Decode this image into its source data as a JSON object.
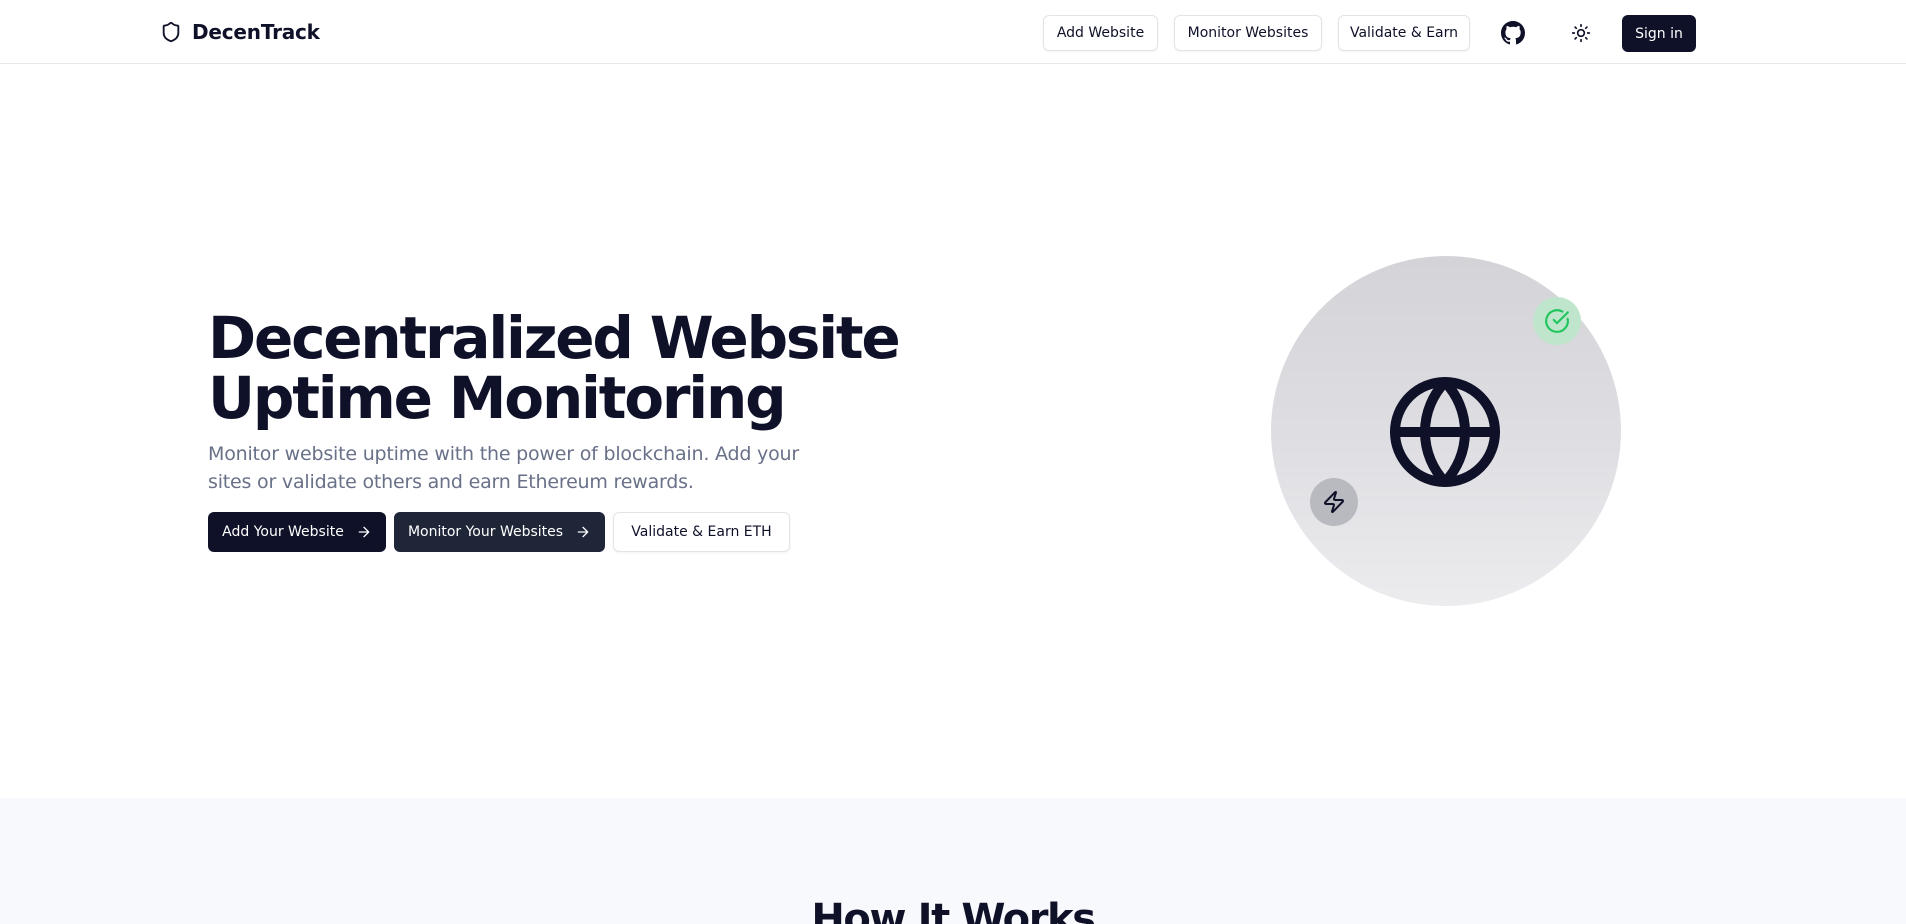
{
  "nav": {
    "brand": "DecenTrack",
    "brand_icon": "shield-icon",
    "links": [
      {
        "label": "Add Website"
      },
      {
        "label": "Monitor Websites"
      },
      {
        "label": "Validate & Earn"
      }
    ],
    "github_icon": "github-icon",
    "theme_icon": "sun-icon",
    "signin_label": "Sign in"
  },
  "hero": {
    "title": "Decentralized Website Uptime Monitoring",
    "subtitle": "Monitor website uptime with the power of blockchain. Add your sites or validate others and earn Ethereum rewards.",
    "buttons": [
      {
        "label": "Add Your Website",
        "icon": "arrow-right-icon"
      },
      {
        "label": "Monitor Your Websites",
        "icon": "arrow-right-icon"
      },
      {
        "label": "Validate & Earn ETH"
      }
    ],
    "illustration": {
      "main_icon": "globe-icon",
      "badges": [
        "check-circle-icon",
        "zap-icon"
      ]
    }
  },
  "how_it_works": {
    "title": "How It Works"
  },
  "colors": {
    "primary": "#0f1129",
    "secondary": "#1e2638",
    "muted_text": "#697189",
    "success": "#22c55e",
    "section_bg": "#f8f9fc"
  }
}
